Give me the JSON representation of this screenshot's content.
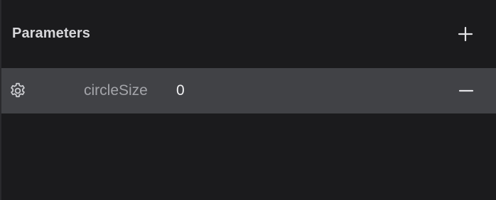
{
  "panel": {
    "title": "Parameters",
    "add_icon": "plus-icon",
    "parameters": [
      {
        "settings_icon": "gear-icon",
        "name": "circleSize",
        "value": "0",
        "remove_icon": "minus-icon"
      }
    ]
  },
  "colors": {
    "background": "#1b1b1d",
    "row_background": "#414246",
    "title": "#d7d7da",
    "param_name": "#a4a5aa",
    "param_value": "#f1f1f3"
  }
}
